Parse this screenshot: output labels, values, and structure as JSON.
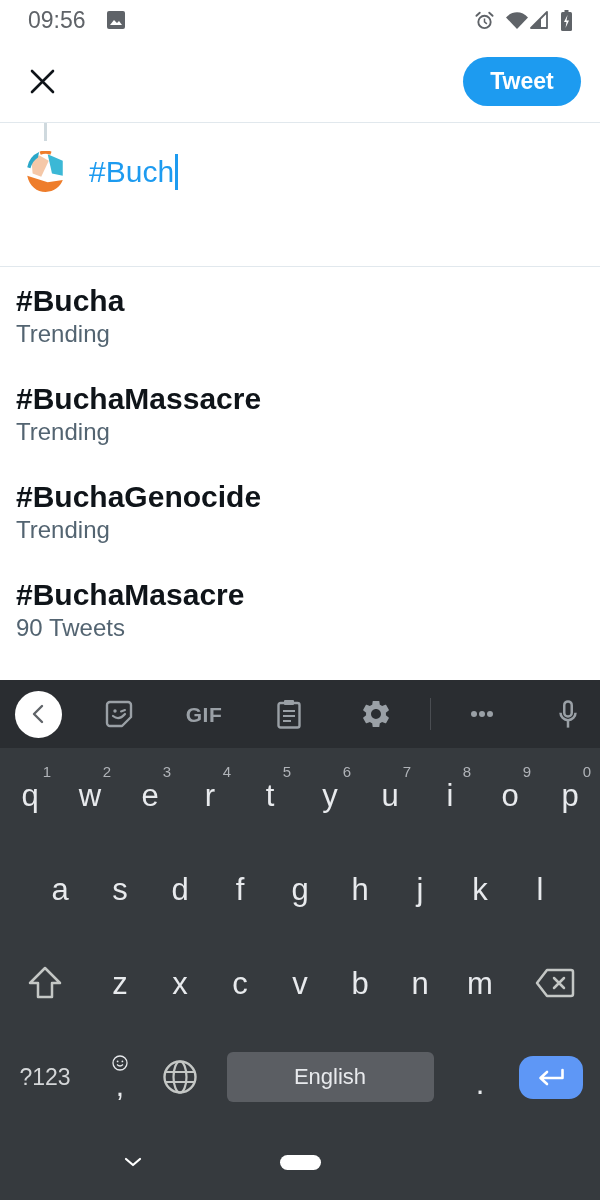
{
  "status_bar": {
    "time": "09:56"
  },
  "header": {
    "tweet_button": "Tweet"
  },
  "compose": {
    "text": "#Buch",
    "focused": true
  },
  "suggestions": [
    {
      "hashtag": "#Bucha",
      "detail": "Trending"
    },
    {
      "hashtag": "#BuchaMassacre",
      "detail": "Trending"
    },
    {
      "hashtag": "#BuchaGenocide",
      "detail": "Trending"
    },
    {
      "hashtag": "#BuchaMasacre",
      "detail": "90 Tweets"
    }
  ],
  "keyboard": {
    "gif_label": "GIF",
    "rows": [
      [
        {
          "kind": "letter",
          "label": "q",
          "hint": "1"
        },
        {
          "kind": "letter",
          "label": "w",
          "hint": "2"
        },
        {
          "kind": "letter",
          "label": "e",
          "hint": "3"
        },
        {
          "kind": "letter",
          "label": "r",
          "hint": "4"
        },
        {
          "kind": "letter",
          "label": "t",
          "hint": "5"
        },
        {
          "kind": "letter",
          "label": "y",
          "hint": "6"
        },
        {
          "kind": "letter",
          "label": "u",
          "hint": "7"
        },
        {
          "kind": "letter",
          "label": "i",
          "hint": "8"
        },
        {
          "kind": "letter",
          "label": "o",
          "hint": "9"
        },
        {
          "kind": "letter",
          "label": "p",
          "hint": "0"
        }
      ],
      [
        {
          "kind": "letter",
          "label": "a"
        },
        {
          "kind": "letter",
          "label": "s"
        },
        {
          "kind": "letter",
          "label": "d"
        },
        {
          "kind": "letter",
          "label": "f"
        },
        {
          "kind": "letter",
          "label": "g"
        },
        {
          "kind": "letter",
          "label": "h"
        },
        {
          "kind": "letter",
          "label": "j"
        },
        {
          "kind": "letter",
          "label": "k"
        },
        {
          "kind": "letter",
          "label": "l"
        }
      ],
      [
        {
          "kind": "shift"
        },
        {
          "kind": "letter",
          "label": "z"
        },
        {
          "kind": "letter",
          "label": "x"
        },
        {
          "kind": "letter",
          "label": "c"
        },
        {
          "kind": "letter",
          "label": "v"
        },
        {
          "kind": "letter",
          "label": "b"
        },
        {
          "kind": "letter",
          "label": "n"
        },
        {
          "kind": "letter",
          "label": "m"
        },
        {
          "kind": "backspace"
        }
      ]
    ],
    "bottom_row": [
      {
        "kind": "symbols",
        "label": "?123"
      },
      {
        "kind": "comma",
        "label": ","
      },
      {
        "kind": "globe"
      },
      {
        "kind": "space",
        "label": "English"
      },
      {
        "kind": "period",
        "label": "."
      },
      {
        "kind": "enter"
      }
    ]
  }
}
